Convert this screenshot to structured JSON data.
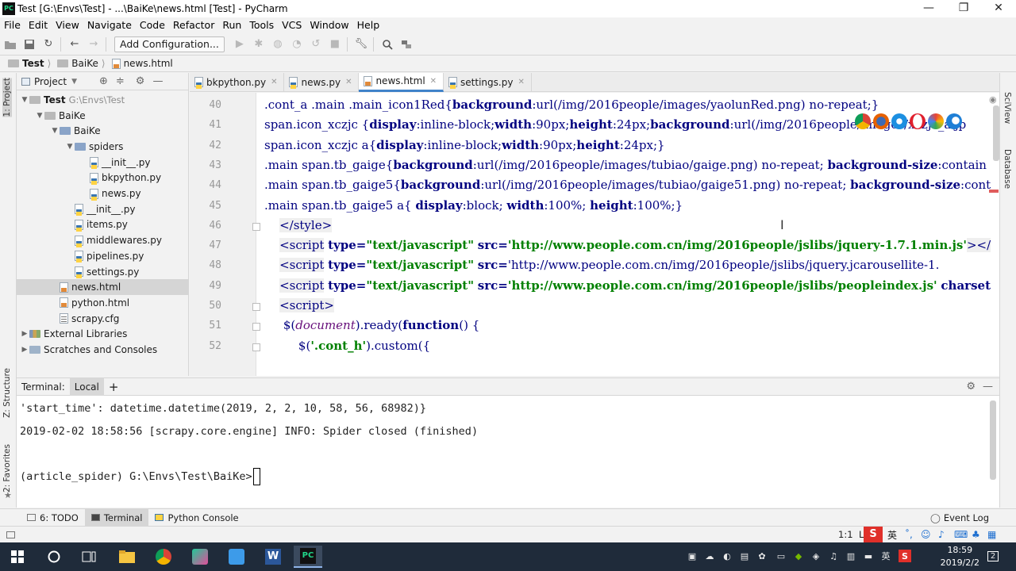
{
  "window": {
    "title": "Test [G:\\Envs\\Test] - ...\\BaiKe\\news.html [Test] - PyCharm",
    "app_logo_text": "PC",
    "minimize": "—",
    "restore": "❐",
    "close": "✕"
  },
  "menu": [
    "File",
    "Edit",
    "View",
    "Navigate",
    "Code",
    "Refactor",
    "Run",
    "Tools",
    "VCS",
    "Window",
    "Help"
  ],
  "toolbar": {
    "add_config_label": "Add Configuration..."
  },
  "breadcrumb": [
    "Test",
    "BaiKe",
    "news.html"
  ],
  "project_panel": {
    "title": "Project",
    "tree": [
      {
        "label": "Test",
        "hint": "G:\\Envs\\Test",
        "depth": 0,
        "kind": "folder",
        "open": true,
        "bold": true
      },
      {
        "label": "BaiKe",
        "depth": 1,
        "kind": "folder",
        "open": true
      },
      {
        "label": "BaiKe",
        "depth": 2,
        "kind": "folder-blue",
        "open": true
      },
      {
        "label": "spiders",
        "depth": 3,
        "kind": "folder-blue",
        "open": true
      },
      {
        "label": "__init__.py",
        "depth": 4,
        "kind": "py"
      },
      {
        "label": "bkpython.py",
        "depth": 4,
        "kind": "py"
      },
      {
        "label": "news.py",
        "depth": 4,
        "kind": "py"
      },
      {
        "label": "__init__.py",
        "depth": 3,
        "kind": "py"
      },
      {
        "label": "items.py",
        "depth": 3,
        "kind": "py"
      },
      {
        "label": "middlewares.py",
        "depth": 3,
        "kind": "py"
      },
      {
        "label": "pipelines.py",
        "depth": 3,
        "kind": "py"
      },
      {
        "label": "settings.py",
        "depth": 3,
        "kind": "py"
      },
      {
        "label": "news.html",
        "depth": 2,
        "kind": "html",
        "selected": true
      },
      {
        "label": "python.html",
        "depth": 2,
        "kind": "html"
      },
      {
        "label": "scrapy.cfg",
        "depth": 2,
        "kind": "cfg"
      },
      {
        "label": "External Libraries",
        "depth": 0,
        "kind": "lib",
        "open": false
      },
      {
        "label": "Scratches and Consoles",
        "depth": 0,
        "kind": "scratch",
        "open": false
      }
    ]
  },
  "editor_tabs": [
    {
      "label": "bkpython.py",
      "kind": "py",
      "active": false
    },
    {
      "label": "news.py",
      "kind": "py",
      "active": false
    },
    {
      "label": "news.html",
      "kind": "html",
      "active": true
    },
    {
      "label": "settings.py",
      "kind": "py",
      "active": false
    }
  ],
  "code": {
    "line_numbers": [
      "40",
      "41",
      "42",
      "43",
      "44",
      "45",
      "46",
      "47",
      "48",
      "49",
      "50",
      "51",
      "52"
    ],
    "lines": [
      ".cont_a .main .main_icon1Red{background:url(/img/2016people/images/yaolunRed.png) no-repeat;}",
      "span.icon_xczjc {display:inline-block;width:90px;height:24px;background:url(/img/2016people/images/xczjc_a.jp",
      "span.icon_xczjc a{display:inline-block;width:90px;height:24px;}",
      ".main span.tb_gaige{background:url(/img/2016people/images/tubiao/gaige.png) no-repeat; background-size:contain",
      ".main span.tb_gaige5{background:url(/img/2016people/images/tubiao/gaige51.png) no-repeat; background-size:cont",
      ".main span.tb_gaige5 a{ display:block; width:100%; height:100%;}",
      "    </style>",
      "    <script type=\"text/javascript\" src='http://www.people.com.cn/img/2016people/jslibs/jquery-1.7.1.min.js'></",
      "    <script type=\"text/javascript\" src='http://www.people.com.cn/img/2016people/jslibs/jquery.jcarousellite-1.",
      "    <script type=\"text/javascript\" src='http://www.people.com.cn/img/2016people/jslibs/peopleindex.js' charset",
      "    <script>",
      "     $(document).ready(function() {",
      "         $('.cont_h').custom({"
    ]
  },
  "terminal": {
    "title": "Terminal:",
    "tab": "Local",
    "add": "+",
    "lines": [
      "'start_time': datetime.datetime(2019, 2, 2, 10, 58, 56, 68982)}",
      "2019-02-02 18:58:56 [scrapy.core.engine] INFO: Spider closed (finished)",
      "",
      "(article_spider) G:\\Envs\\Test\\BaiKe>"
    ]
  },
  "side_tabs": {
    "left": [
      "1: Project",
      "Z: Structure",
      "2: Favorites"
    ],
    "right": [
      "SciView",
      "Database"
    ]
  },
  "tool_tabs": [
    {
      "label": "6: TODO",
      "active": false
    },
    {
      "label": "Terminal",
      "active": true
    },
    {
      "label": "Python Console",
      "active": false
    }
  ],
  "status": {
    "event_log": "Event Log",
    "position": "1:1",
    "lf": "LF",
    "ime": "英"
  },
  "taskbar": {
    "time": "18:59",
    "date": "2019/2/2",
    "lang": "英",
    "notifications": "2"
  },
  "colors": {
    "accent": "#4083c9",
    "keyword": "#000080",
    "string": "#008000",
    "taskbar": "#1f2b3a"
  }
}
